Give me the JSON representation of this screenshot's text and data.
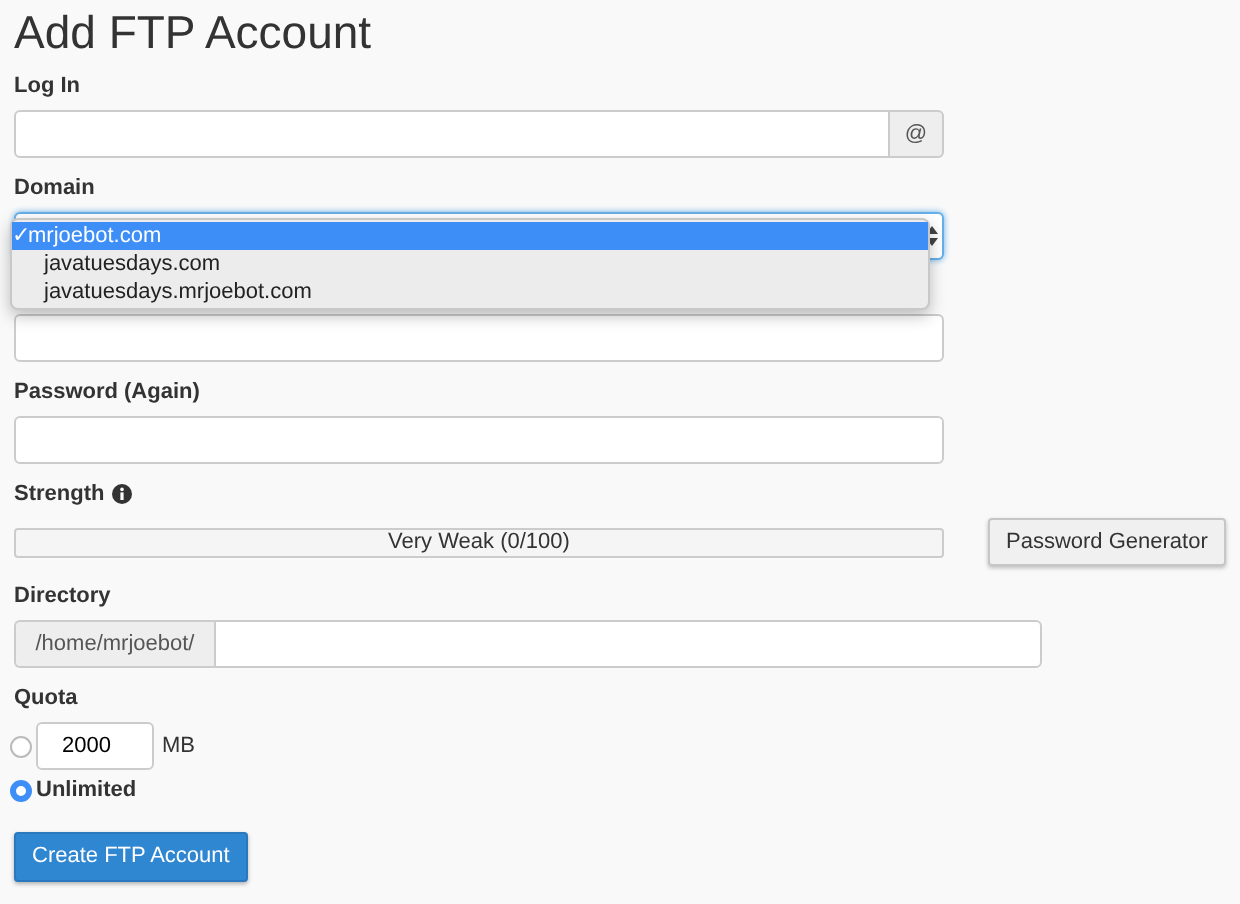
{
  "title": "Add FTP Account",
  "login": {
    "label": "Log In",
    "addon": "@"
  },
  "domain": {
    "label": "Domain",
    "expanded": true,
    "check_mark": "✓",
    "options": [
      {
        "label": "mrjoebot.com",
        "selected": true
      },
      {
        "label": "javatuesdays.com",
        "selected": false
      },
      {
        "label": "javatuesdays.mrjoebot.com",
        "selected": false
      }
    ]
  },
  "password_again": {
    "label": "Password (Again)"
  },
  "strength": {
    "label": "Strength",
    "level": 0,
    "reading": "Very Weak (0/100)",
    "button": "Password Generator"
  },
  "directory": {
    "label": "Directory",
    "prefix": "/home/mrjoebot/"
  },
  "quota": {
    "label": "Quota",
    "options": [
      {
        "kind": "amount",
        "value": "2000",
        "unit": "MB",
        "selected": false
      },
      {
        "kind": "unlimited",
        "label": "Unlimited",
        "selected": true
      }
    ]
  },
  "submit": "Create FTP Account"
}
